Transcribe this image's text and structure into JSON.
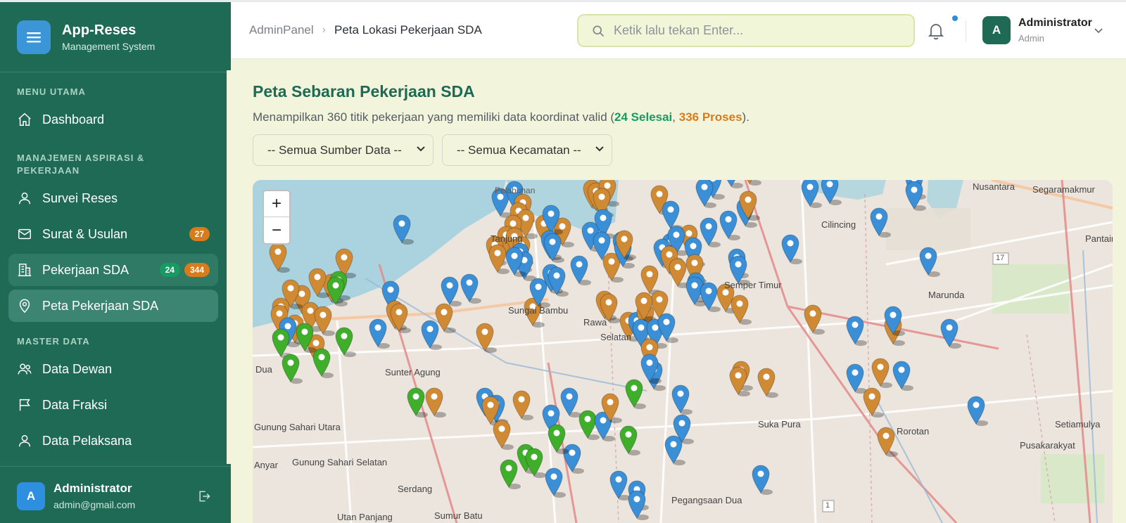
{
  "app": {
    "title": "App-Reses",
    "subtitle": "Management System"
  },
  "sidebar": {
    "sections": {
      "main": "MENU UTAMA",
      "aspirasi_line1": "MANAJEMEN ASPIRASI &",
      "aspirasi_line2": "PEKERJAAN",
      "master": "MASTER DATA"
    },
    "items": [
      {
        "label": "Dashboard",
        "icon": "home-icon"
      },
      {
        "label": "Survei Reses",
        "icon": "user-icon"
      },
      {
        "label": "Surat & Usulan",
        "icon": "mail-icon",
        "badge": "27"
      },
      {
        "label": "Pekerjaan SDA",
        "icon": "building-icon",
        "badge_green": "24",
        "badge_orange": "344"
      },
      {
        "label": "Peta Pekerjaan SDA",
        "icon": "map-pin-icon"
      },
      {
        "label": "Data Dewan",
        "icon": "users-icon"
      },
      {
        "label": "Data Fraksi",
        "icon": "flag-icon"
      },
      {
        "label": "Data Pelaksana",
        "icon": "user-icon"
      }
    ],
    "user": {
      "initial": "A",
      "name": "Administrator",
      "email": "admin@gmail.com"
    }
  },
  "header": {
    "breadcrumb": [
      "AdminPanel",
      "Peta Lokasi Pekerjaan SDA"
    ],
    "search_placeholder": "Ketik lalu tekan Enter...",
    "user": {
      "initial": "A",
      "name": "Administrator",
      "role": "Admin"
    }
  },
  "main": {
    "title": "Peta Sebaran Pekerjaan SDA",
    "desc_prefix": "Menampilkan 360 titik pekerjaan yang memiliki data koordinat valid (",
    "desc_done": "24 Selesai",
    "desc_sep": ", ",
    "desc_process": "336 Proses",
    "desc_suffix": ").",
    "filter_source": "-- Semua Sumber Data --",
    "filter_district": "-- Semua Kecamatan --"
  },
  "map": {
    "zoom_in": "+",
    "zoom_out": "−",
    "labels": {
      "nusantara": "Nusantara",
      "segaramakmur": "Segaramakmur",
      "pelabuhan": "Pelabuhan",
      "cilincing": "Cilincing",
      "tanjung": "Tanjung",
      "semper_timur": "Semper Timur",
      "marunda": "Marunda",
      "pantai": "Pantaim",
      "sunter_agung": "Sunter Agung",
      "sungai_bambu": "Sungai Bambu",
      "selatan": "Selatan",
      "rawa": "Rawa",
      "gunung_sahari_utara": "Gunung Sahari Utara",
      "gunung_sahari_selatan": "Gunung Sahari Selatan",
      "anyar": "Anyar",
      "serdang": "Serdang",
      "sumur_batu": "Sumur Batu",
      "utan_panjang": "Utan Panjang",
      "suka_pura": "Suka Pura",
      "rorotan": "Rorotan",
      "setiamulya": "Setiamulya",
      "pusakarakyat": "Pusakarakyat",
      "pegangsaan_dua": "Pegangsaan Dua",
      "dua": "Dua",
      "road_17": "17",
      "road_1": "1"
    },
    "pin_colors": {
      "proses": "#d08a34",
      "selesai": "#3fae2a",
      "other": "#3a8fd6"
    }
  }
}
